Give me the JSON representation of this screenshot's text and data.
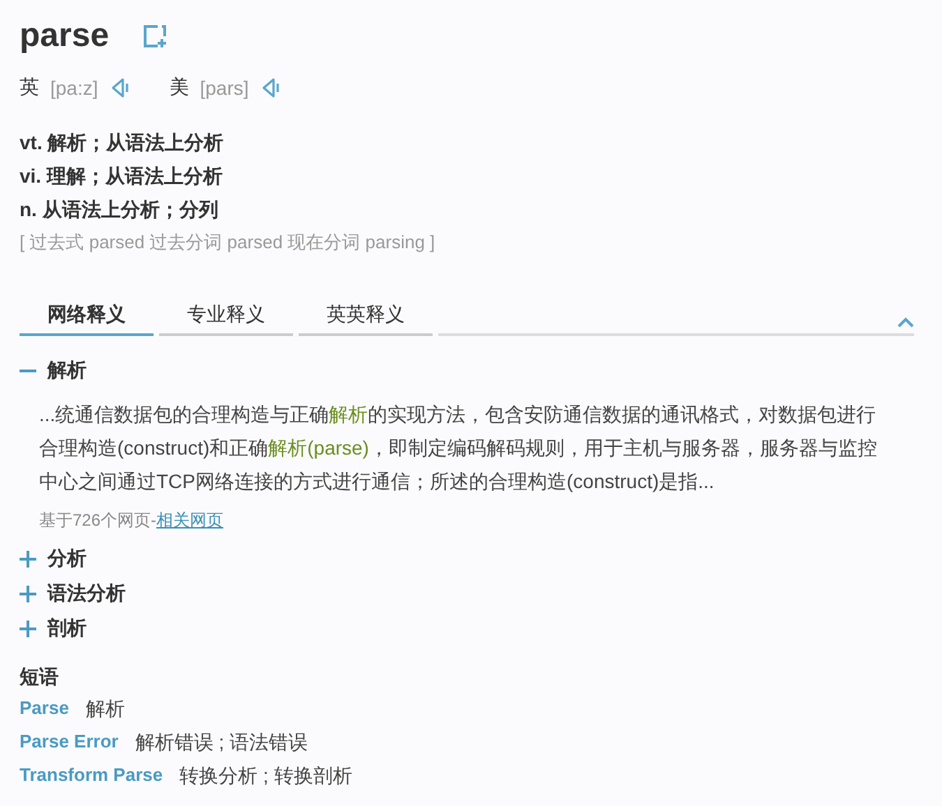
{
  "word": "parse",
  "pronunciations": [
    {
      "region": "英",
      "phonetic": "[pa:z]"
    },
    {
      "region": "美",
      "phonetic": "[pars]"
    }
  ],
  "definitions": [
    {
      "pos": "vt.",
      "meaning": "解析；从语法上分析"
    },
    {
      "pos": "vi.",
      "meaning": "理解；从语法上分析"
    },
    {
      "pos": "n.",
      "meaning": "从语法上分析；分列"
    }
  ],
  "forms": "[ 过去式 parsed 过去分词 parsed 现在分词 parsing ]",
  "tabs": [
    {
      "label": "网络释义",
      "selected": true
    },
    {
      "label": "专业释义",
      "selected": false
    },
    {
      "label": "英英释义",
      "selected": false
    }
  ],
  "senses": [
    {
      "term": "解析",
      "expanded": true,
      "excerpt": [
        {
          "text": "...统通信数据包的合理构造与正确",
          "highlight": false
        },
        {
          "text": "解析",
          "highlight": true
        },
        {
          "text": "的实现方法，包含安防通信数据的通讯格式，对数据包进行合理构造(construct)和正确",
          "highlight": false
        },
        {
          "text": "解析(parse)",
          "highlight": true
        },
        {
          "text": "，即制定编码解码规则，用于主机与服务器，服务器与监控中心之间通过TCP网络连接的方式进行通信；所述的合理构造(construct)是指...",
          "highlight": false
        }
      ],
      "source": "基于726个网页-",
      "source_link": "相关网页"
    },
    {
      "term": "分析",
      "expanded": false
    },
    {
      "term": "语法分析",
      "expanded": false
    },
    {
      "term": "剖析",
      "expanded": false
    }
  ],
  "phrases_title": "短语",
  "phrases": [
    {
      "phrase": "Parse",
      "meaning": "解析"
    },
    {
      "phrase": "Parse Error",
      "meaning": "解析错误 ; 语法错误"
    },
    {
      "phrase": "Transform Parse",
      "meaning": "转换分析 ; 转换剖析"
    }
  ]
}
